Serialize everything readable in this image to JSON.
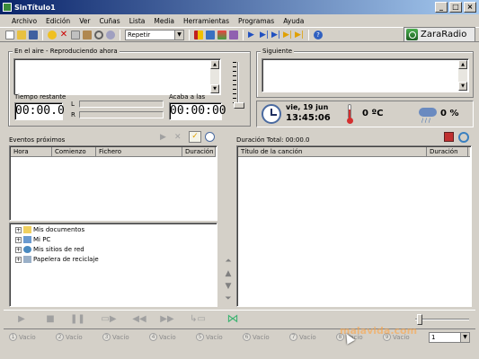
{
  "window": {
    "title": "SinTítulo1",
    "min": "_",
    "max": "□",
    "close": "×"
  },
  "menu": [
    "Archivo",
    "Edición",
    "Ver",
    "Cuñas",
    "Lista",
    "Media",
    "Herramientas",
    "Programas",
    "Ayuda"
  ],
  "toolbar": {
    "repeat_value": "Repetir",
    "logo_text": "ZaraRadio"
  },
  "on_air": {
    "label": "En el aire - Reproduciendo ahora",
    "remaining_label": "Tiempo restante",
    "remaining_value": "00:00.0",
    "ends_label": "Acaba a las",
    "ends_value": "00:00:00",
    "left_channel": "L",
    "right_channel": "R"
  },
  "next": {
    "label": "Siguiente"
  },
  "status": {
    "date": "vie, 19 jun",
    "time": "13:45:06",
    "temperature": "0 ºC",
    "humidity": "0 %"
  },
  "events": {
    "label": "Eventos próximos",
    "columns": [
      "Hora",
      "Comienzo",
      "Fichero",
      "Duración"
    ]
  },
  "tree": [
    "Mis documentos",
    "Mi PC",
    "Mis sitios de red",
    "Papelera de reciclaje"
  ],
  "playlist": {
    "total_label": "Duración Total: 00:00.0",
    "columns": [
      "Título de la canción",
      "Duración"
    ]
  },
  "slots": [
    {
      "num": "1",
      "label": "Vacío"
    },
    {
      "num": "2",
      "label": "Vacío"
    },
    {
      "num": "3",
      "label": "Vacío"
    },
    {
      "num": "4",
      "label": "Vacío"
    },
    {
      "num": "5",
      "label": "Vacío"
    },
    {
      "num": "6",
      "label": "Vacío"
    },
    {
      "num": "7",
      "label": "Vacío"
    },
    {
      "num": "8",
      "label": "Vacío"
    },
    {
      "num": "9",
      "label": "Vacío"
    }
  ],
  "page_select": "1",
  "watermark": "malavida.com",
  "colors": {
    "titlebar_start": "#0a246a",
    "titlebar_end": "#a6caf0",
    "window_bg": "#d4d0c8",
    "temp_red": "#d32f2f",
    "crossfade_green": "#3cb371"
  }
}
